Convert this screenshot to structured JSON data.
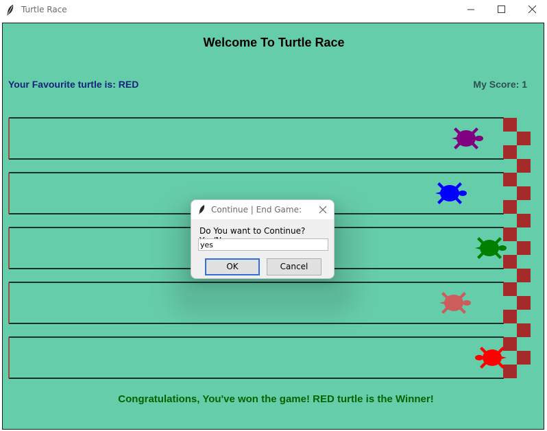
{
  "window": {
    "title": "Turtle Race",
    "icon": "feather-icon"
  },
  "game": {
    "heading": "Welcome To Turtle Race",
    "favourite": "Your Favourite turtle is: RED",
    "score": "My Score: 1",
    "result": "Congratulations, You've won the game! RED turtle is the Winner!",
    "background_color": "#66cdaa",
    "finish_line_color": "#a52a2a",
    "lanes": [
      {
        "turtle_color": "#800080"
      },
      {
        "turtle_color": "#0000ff"
      },
      {
        "turtle_color": "#008000"
      },
      {
        "turtle_color": "#cd5c5c"
      },
      {
        "turtle_color": "#ff0000"
      }
    ]
  },
  "dialog": {
    "title": "Continue | End Game:",
    "prompt": "Do You want to Continue? Yes/No",
    "input_value": "yes",
    "ok_label": "OK",
    "cancel_label": "Cancel"
  }
}
